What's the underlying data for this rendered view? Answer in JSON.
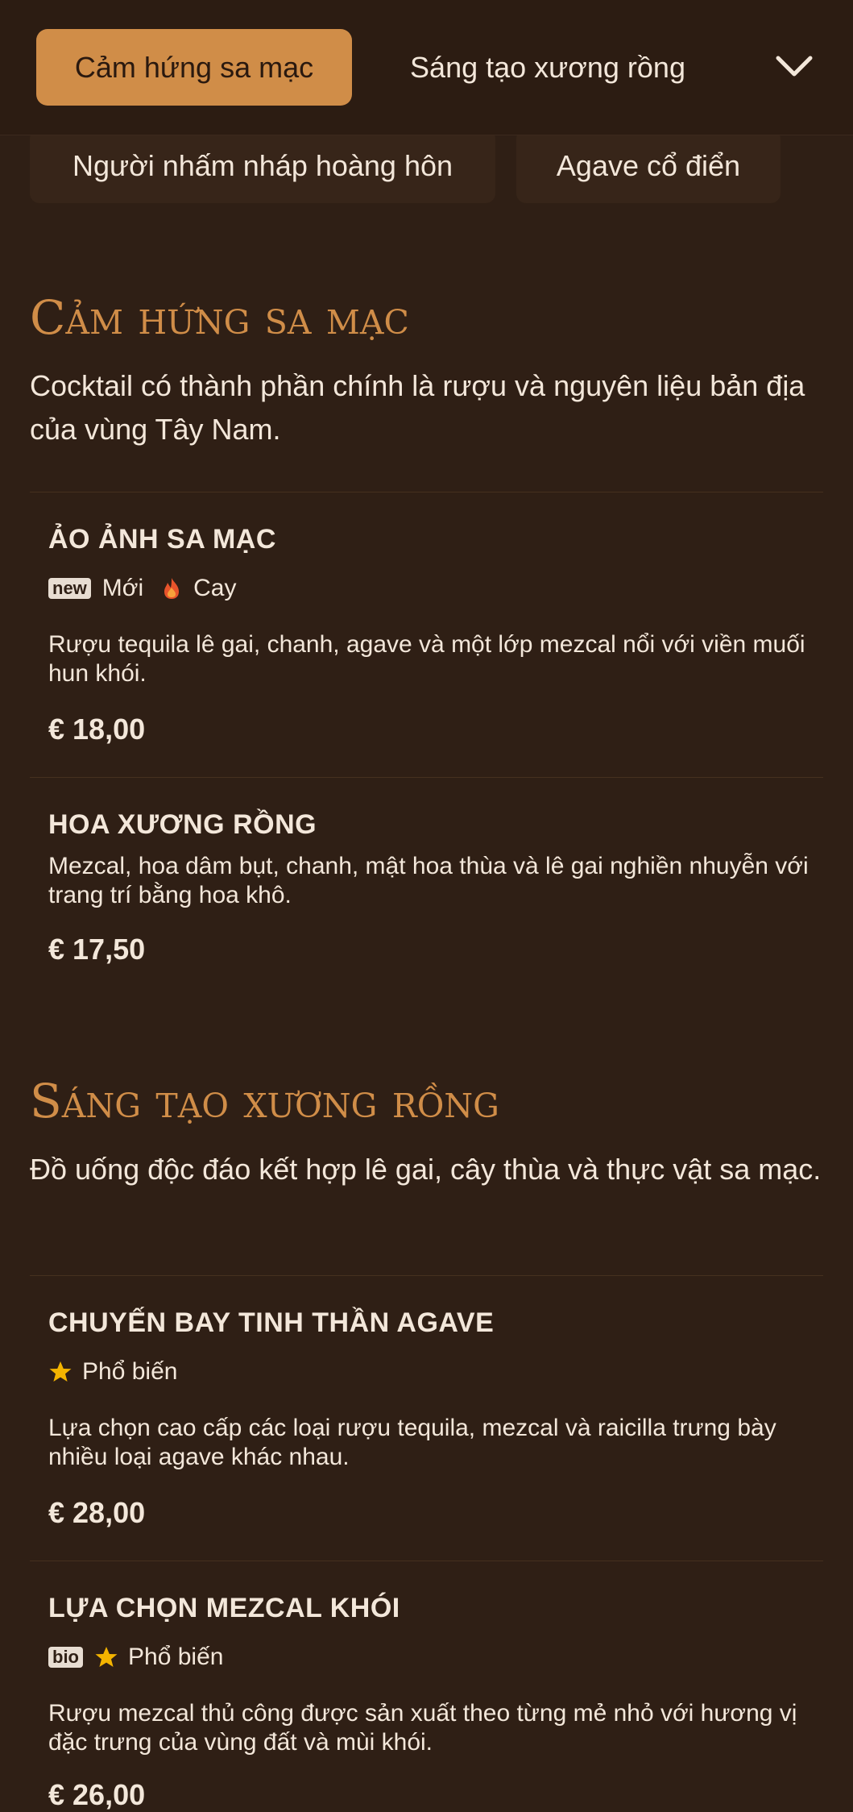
{
  "category_bar": {
    "active_tab": "Cảm hứng sa mạc",
    "next_tab": "Sáng tạo xương rồng",
    "expand_icon": "chevron-down-icon",
    "more_tabs": [
      "Người nhấm nháp hoàng hôn",
      "Agave cổ điển"
    ]
  },
  "colors": {
    "background": "#2f1f15",
    "accent": "#d08d48",
    "text": "#f3e7da",
    "star": "#f4b400",
    "fire": "#e8542b"
  },
  "sections": [
    {
      "title": "Cảm hứng sa mạc",
      "description": "Cocktail có thành phần chính là rượu và nguyên liệu bản địa của vùng Tây Nam.",
      "items": [
        {
          "name": "ẢO ẢNH SA MẠC",
          "badges": [
            {
              "box": "new",
              "label": "Mới"
            },
            {
              "icon": "fire-icon",
              "label": "Cay"
            }
          ],
          "description": "Rượu tequila lê gai, chanh, agave và một lớp mezcal nổi với viền muối hun khói.",
          "price": "€ 18,00"
        },
        {
          "name": "HOA XƯƠNG RỒNG",
          "badges": [],
          "description": "Mezcal, hoa dâm bụt, chanh, mật hoa thùa và lê gai nghiền nhuyễn với trang trí bằng hoa khô.",
          "price": "€ 17,50"
        }
      ]
    },
    {
      "title": "Sáng tạo xương rồng",
      "description": "Đồ uống độc đáo kết hợp lê gai, cây thùa và thực vật sa mạc.",
      "items": [
        {
          "name": "CHUYẾN BAY TINH THẦN AGAVE",
          "badges": [
            {
              "icon": "star-icon",
              "label": "Phổ biến"
            }
          ],
          "description": "Lựa chọn cao cấp các loại rượu tequila, mezcal và raicilla trưng bày nhiều loại agave khác nhau.",
          "price": "€ 28,00"
        },
        {
          "name": "LỰA CHỌN MEZCAL KHÓI",
          "badges": [
            {
              "box": "bio"
            },
            {
              "icon": "star-icon",
              "label": "Phổ biến"
            }
          ],
          "description": "Rượu mezcal thủ công được sản xuất theo từng mẻ nhỏ với hương vị đặc trưng của vùng đất và mùi khói.",
          "price": "€ 26,00"
        }
      ]
    }
  ]
}
